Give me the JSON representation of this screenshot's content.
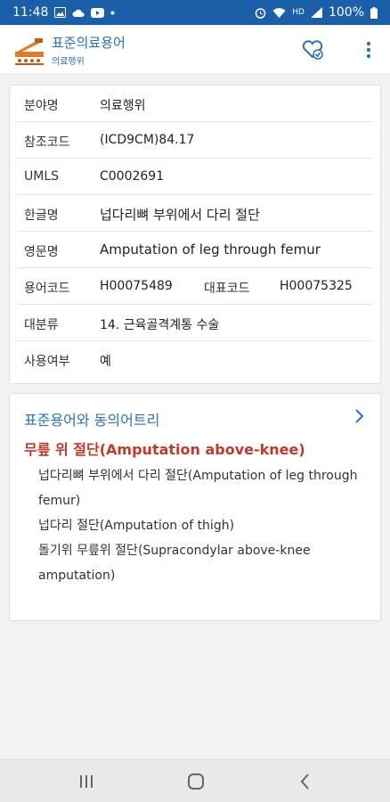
{
  "status_bar": {
    "time": "11:48",
    "battery": "100%",
    "network_label": "HD"
  },
  "app_bar": {
    "title": "표준의료용어",
    "subtitle": "의료행위"
  },
  "detail": {
    "rows": [
      {
        "label": "분야명",
        "value": "의료행위"
      },
      {
        "label": "참조코드",
        "value": "(ICD9CM)84.17"
      },
      {
        "label": "UMLS",
        "value": "C0002691"
      },
      {
        "label": "한글명",
        "value": "넙다리뼈 부위에서 다리 절단"
      },
      {
        "label": "영문명",
        "value": "Amputation of leg through femur"
      },
      {
        "label": "용어코드",
        "value": "H00075489",
        "label2": "대표코드",
        "value2": "H00075325"
      },
      {
        "label": "대분류",
        "value": "14. 근육골격계통 수술"
      },
      {
        "label": "사용여부",
        "value": "예"
      }
    ]
  },
  "tree": {
    "header": "표준용어와 동의어트리",
    "main_term": "무릎 위 절단(Amputation above-knee)",
    "items": [
      "넙다리뼈 부위에서 다리 절단(Amputation of leg through femur)",
      "넙다리 절단(Amputation of thigh)",
      "돌기위 무릎위 절단(Supracondylar above-knee amputation)"
    ]
  },
  "colors": {
    "accent": "#2a73b8",
    "status_bar": "#1a5fa8",
    "main_term": "#c0392b"
  },
  "icons": [
    "app-logo-icon",
    "favorite-heart-check-icon",
    "more-vert-icon",
    "chevron-right-icon",
    "recent-apps-icon",
    "home-icon",
    "back-icon"
  ]
}
